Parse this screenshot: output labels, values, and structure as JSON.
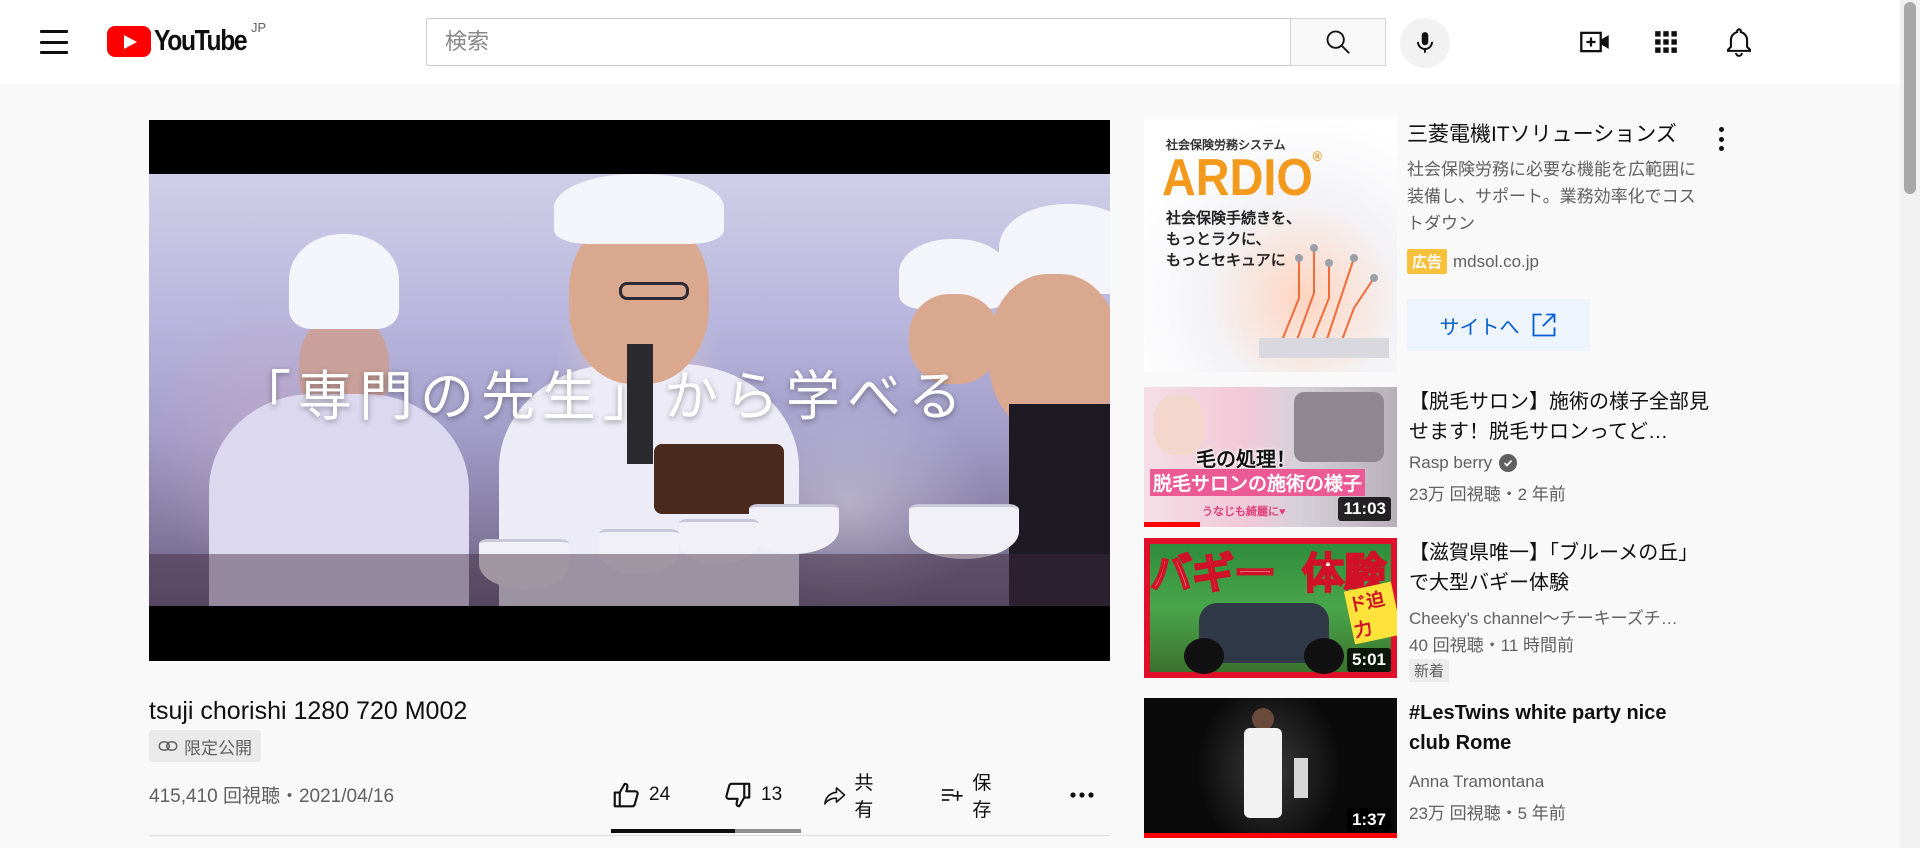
{
  "header": {
    "logo_text": "YouTube",
    "country": "JP",
    "search_placeholder": "検索",
    "icons": [
      "hamburger-menu-icon",
      "search-icon",
      "mic-icon",
      "create-video-icon",
      "apps-grid-icon",
      "notifications-bell-icon"
    ]
  },
  "player": {
    "overlay_text": "「専門の先生」から学べる"
  },
  "video": {
    "title": "tsuji chorishi 1280 720 M002",
    "visibility": "限定公開",
    "view_info": "415,410 回視聴・2021/04/16",
    "likes": "24",
    "dislikes": "13",
    "like_ratio": 0.65,
    "share_label": "共有",
    "save_label": "保存"
  },
  "sidebar": {
    "ad": {
      "thumb_small": "社会保険労務システム",
      "thumb_brand": "ARDIO",
      "thumb_reg": "®",
      "thumb_tagline_1": "社会保険手続きを、",
      "thumb_tagline_2": "もっとラクに、",
      "thumb_tagline_3": "もっとセキュアに",
      "title": "三菱電機ITソリューションズ",
      "description": "社会保険労務に必要な機能を広範囲に装備し、サポート。業務効率化でコストダウン",
      "badge": "広告",
      "domain": "mdsol.co.jp",
      "site_button": "サイトへ"
    },
    "recommendations": [
      {
        "title": "【脱毛サロン】施術の様子全部見せます！脱毛サロンってど…",
        "channel": "Rasp berry",
        "verified": true,
        "meta": "23万 回視聴・2 年前",
        "duration": "11:03",
        "watched": 0.22,
        "thumb_caption_1": "毛の処理！",
        "thumb_caption_2": "脱毛サロンの施術の様子",
        "thumb_caption_3": "うなじも綺麗に♥"
      },
      {
        "title": "【滋賀県唯一】「ブルーメの丘」で大型バギー体験",
        "channel": "Cheeky's channel～チーキーズチ…",
        "verified": false,
        "meta": "40 回視聴・11 時間前",
        "new_badge": "新着",
        "duration": "5:01",
        "thumb_caption_1": "バギー",
        "thumb_caption_2": "体験",
        "thumb_caption_3": "ド迫力"
      },
      {
        "title": "#LesTwins white party nice club Rome",
        "channel": "Anna Tramontana",
        "verified": false,
        "meta": "23万 回視聴・5 年前",
        "duration": "1:37",
        "watched": 1.0
      }
    ]
  },
  "colors": {
    "brand_red": "#ff0000",
    "link_blue": "#065fd4",
    "ad_badge": "#f7c13b",
    "secondary_text": "#606060"
  }
}
